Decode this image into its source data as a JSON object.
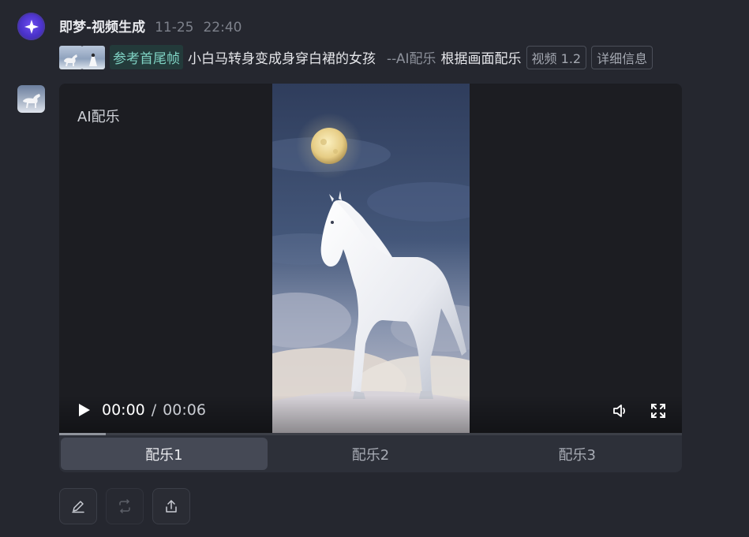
{
  "message": {
    "bot_name": "即梦-视频生成",
    "date": "11-25",
    "time": "22:40",
    "bot_avatar_icon": "sparkle-star-icon",
    "ref_tag": "参考首尾帧",
    "prompt": "小白马转身变成身穿白裙的女孩",
    "music_prefix": "--AI配乐",
    "music_desc": "根据画面配乐",
    "badges": [
      "视频 1.2",
      "详细信息"
    ]
  },
  "video": {
    "label": "AI配乐",
    "current_time": "00:00",
    "separator": "/",
    "duration": "00:06",
    "progress_fraction": 0.075,
    "icons": {
      "play": "play-icon",
      "volume": "volume-icon",
      "fullscreen": "fullscreen-icon"
    }
  },
  "tabs": {
    "items": [
      "配乐1",
      "配乐2",
      "配乐3"
    ],
    "active_index": 0
  },
  "actions": [
    {
      "icon": "edit-pencil-icon",
      "enabled": true
    },
    {
      "icon": "regenerate-icon",
      "enabled": false
    },
    {
      "icon": "share-upload-icon",
      "enabled": true
    }
  ],
  "colors": {
    "background": "#25272f",
    "ref_tag_text": "#7fd3c4",
    "ref_tag_bg": "#233a3a",
    "active_tab": "#454955"
  }
}
